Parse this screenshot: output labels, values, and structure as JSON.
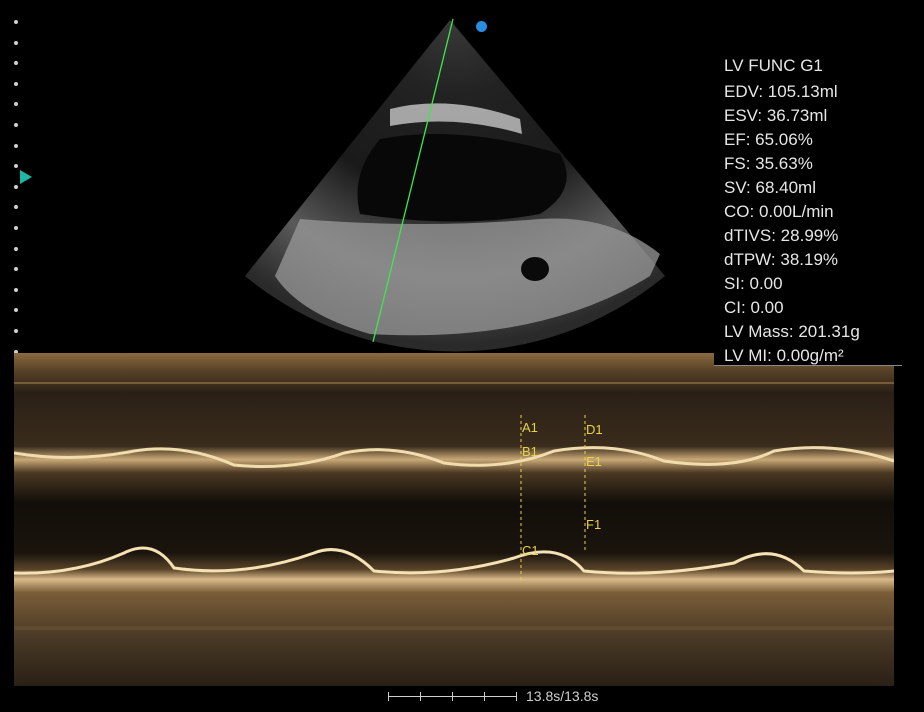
{
  "measurements": {
    "title": "LV FUNC G1",
    "rows": [
      "EDV: 105.13ml",
      "ESV: 36.73ml",
      "EF: 65.06%",
      "FS: 35.63%",
      "SV: 68.40ml",
      "CO: 0.00L/min",
      "dTIVS: 28.99%",
      "dTPW: 38.19%",
      "SI: 0.00",
      "CI: 0.00",
      "LV Mass: 201.31g",
      "LV MI: 0.00g/m²"
    ]
  },
  "calipers": {
    "a1": "A1",
    "b1": "B1",
    "c1": "C1",
    "d1": "D1",
    "e1": "E1",
    "f1": "F1"
  },
  "time_scale": {
    "label": "13.8s/13.8s"
  },
  "colors": {
    "cursor_line": "#3ee84a",
    "orientation_marker": "#2a8be0",
    "focus_marker": "#1fb6a6",
    "caliper": "#e8d24a",
    "mmode_tint": "#b08a55"
  }
}
